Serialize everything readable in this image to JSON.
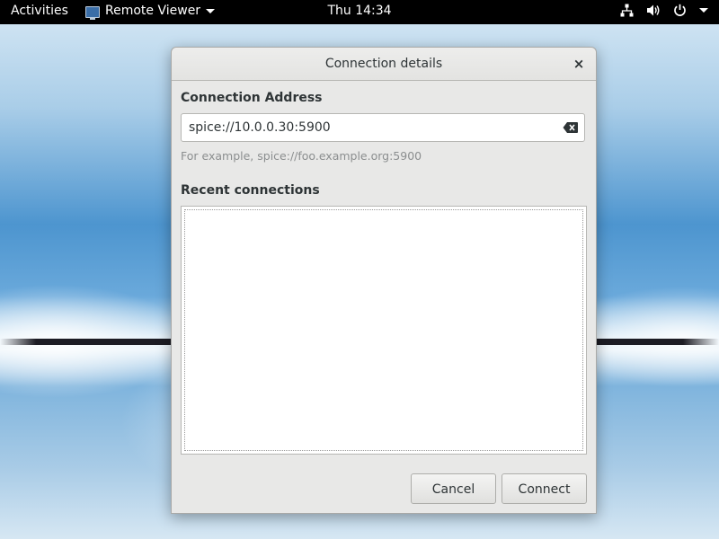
{
  "topbar": {
    "activities_label": "Activities",
    "app_name": "Remote Viewer",
    "clock": "Thu 14:34",
    "icons": [
      "network-icon",
      "volume-icon",
      "power-icon",
      "chevron-down-icon"
    ]
  },
  "dialog": {
    "title": "Connection details",
    "close_glyph": "×",
    "address_label": "Connection Address",
    "address_value": "spice://10.0.0.30:5900",
    "address_hint": "For example, spice://foo.example.org:5900",
    "recent_label": "Recent connections",
    "recent_items": [],
    "cancel_label": "Cancel",
    "connect_label": "Connect"
  },
  "colors": {
    "topbar_bg": "#000000",
    "dialog_bg": "#e8e8e7",
    "text": "#2e3436",
    "hint_text": "#8b8e8f"
  }
}
